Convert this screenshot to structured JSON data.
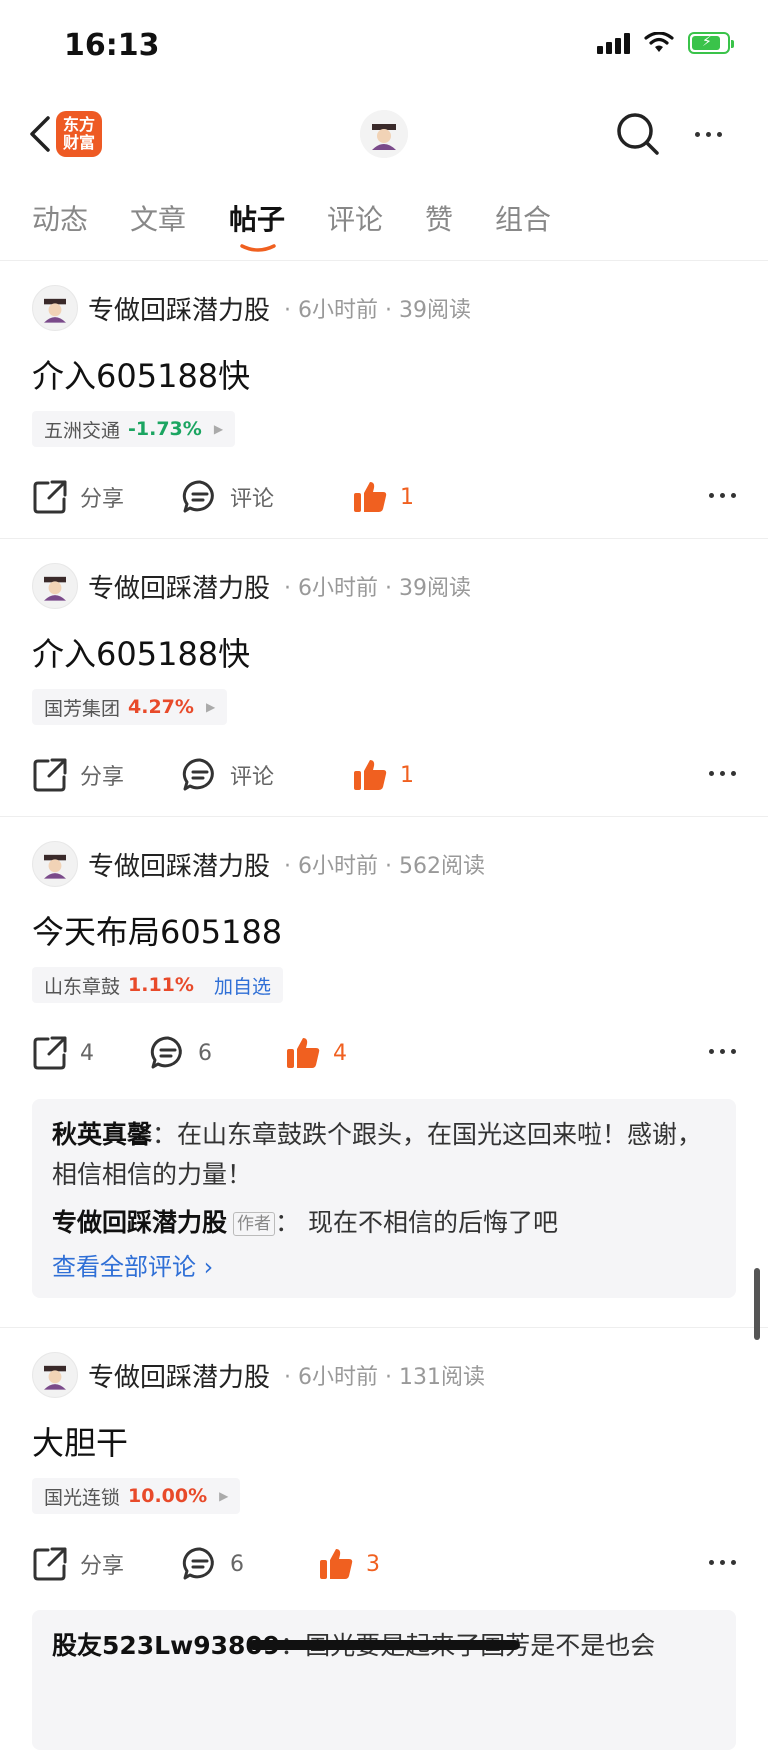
{
  "status": {
    "time": "16:13"
  },
  "nav": {
    "logo_line1": "东方",
    "logo_line2": "财富"
  },
  "tabs": [
    {
      "label": "动态"
    },
    {
      "label": "文章"
    },
    {
      "label": "帖子"
    },
    {
      "label": "评论"
    },
    {
      "label": "赞"
    },
    {
      "label": "组合"
    }
  ],
  "active_tab": "帖子",
  "posts": [
    {
      "author": "专做回踩潜力股",
      "meta": "· 6小时前 · 39阅读",
      "title": "介入605188快",
      "stock": {
        "name": "五洲交通",
        "pct": "-1.73%"
      },
      "share": "分享",
      "comment": "评论",
      "likes": "1"
    },
    {
      "author": "专做回踩潜力股",
      "meta": "· 6小时前 · 39阅读",
      "title": "介入605188快",
      "stock": {
        "name": "国芳集团",
        "pct": "4.27%"
      },
      "share": "分享",
      "comment": "评论",
      "likes": "1"
    },
    {
      "author": "专做回踩潜力股",
      "meta": "· 6小时前 · 562阅读",
      "title": "今天布局605188",
      "stock": {
        "name": "山东章鼓",
        "pct": "1.11%",
        "add": "加自选"
      },
      "share": "4",
      "comment": "6",
      "likes": "4",
      "comments": [
        {
          "user": "秋英真馨",
          "text": "在山东章鼓跌个跟头，在国光这回来啦！感谢，相信相信的力量！"
        },
        {
          "user": "专做回踩潜力股",
          "tag": "作者",
          "text": "现在不相信的后悔了吧"
        }
      ],
      "view_all": "查看全部评论 ›"
    },
    {
      "author": "专做回踩潜力股",
      "meta": "· 6小时前 · 131阅读",
      "title": "大胆干",
      "stock": {
        "name": "国光连锁",
        "pct": "10.00%"
      },
      "share": "分享",
      "comment": "6",
      "likes": "3",
      "comments": [
        {
          "user": "股友523Lw93809",
          "text": "国光要是起来了国芳是不是也会"
        }
      ]
    }
  ]
}
